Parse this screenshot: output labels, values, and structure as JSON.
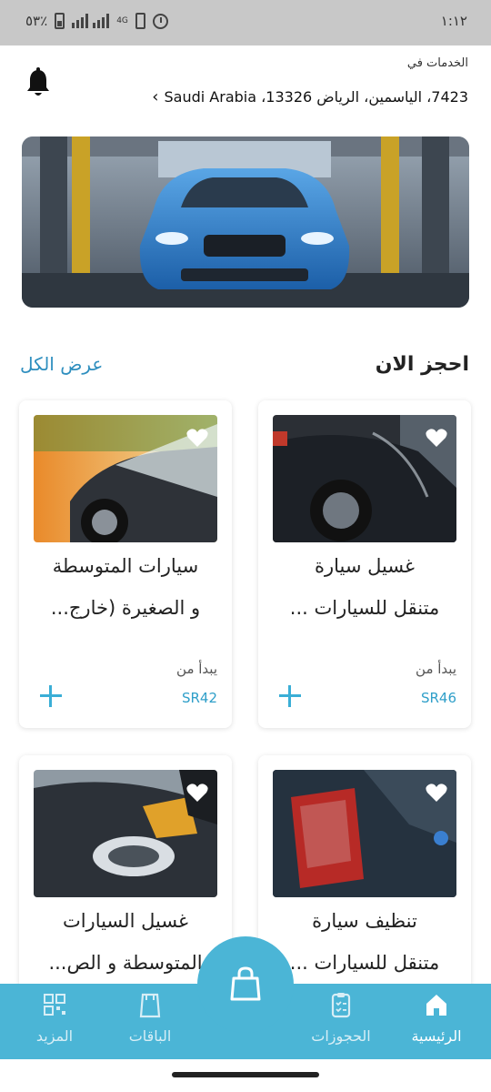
{
  "status_bar": {
    "time": "١:١٢",
    "battery": "٥٣٪",
    "network": "4G"
  },
  "header": {
    "label": "الخدمات في",
    "address": "7423، الياسمين، الرياض 13326، Saudi Arabia"
  },
  "section": {
    "title": "احجز الان",
    "see_all": "عرض الكل"
  },
  "services": [
    {
      "title_line1": "غسيل سيارة",
      "title_line2": "متنقل للسيارات ...",
      "from_label": "يبدأ من",
      "price": "SR46"
    },
    {
      "title_line1": "سيارات المتوسطة",
      "title_line2": "و الصغيرة (خارج...",
      "from_label": "يبدأ من",
      "price": "SR42"
    },
    {
      "title_line1": "تنظيف سيارة",
      "title_line2": "متنقل للسيارات ...",
      "from_label": "",
      "price": ""
    },
    {
      "title_line1": "غسيل السيارات",
      "title_line2": "المتوسطة و الص...",
      "from_label": "",
      "price": ""
    }
  ],
  "nav": {
    "home": "الرئيسية",
    "bookings": "الحجوزات",
    "packages": "الباقات",
    "more": "المزيد"
  },
  "colors": {
    "accent": "#4bb5d6",
    "link": "#2f8fbf",
    "price": "#2f9fc9"
  },
  "icons": [
    "bell-icon",
    "chevron-left-icon",
    "heart-icon",
    "plus-icon",
    "home-icon",
    "clipboard-icon",
    "bag-icon",
    "grid-icon",
    "shopping-bag-icon"
  ]
}
